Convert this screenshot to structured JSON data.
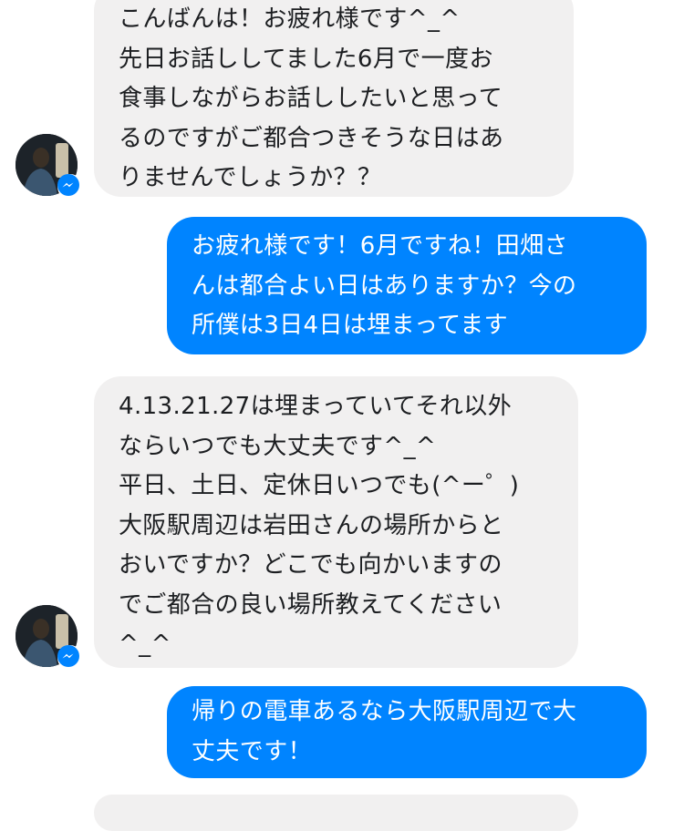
{
  "messages": [
    {
      "sender": "other",
      "lines": [
        "こんばんは！お疲れ様です^_^",
        "先日お話ししてました6月で一度お",
        "食事しながらお話ししたいと思って",
        "るのですがご都合つきそうな日はあ",
        "りませんでしょうか？？"
      ]
    },
    {
      "sender": "me",
      "lines": [
        "お疲れ様です！6月ですね！田畑さ",
        "んは都合よい日はありますか？今の",
        "所僕は3日4日は埋まってます"
      ]
    },
    {
      "sender": "other",
      "lines": [
        "4.13.21.27は埋まっていてそれ以外",
        "ならいつでも大丈夫です^_^",
        "平日、土日、定休日いつでも(^ー゜)",
        "大阪駅周辺は岩田さんの場所からと",
        "おいですか？どこでも向かいますの",
        "でご都合の良い場所教えてください",
        "^_^"
      ]
    },
    {
      "sender": "me",
      "lines": [
        "帰りの電車あるなら大阪駅周辺で大",
        "丈夫です！"
      ]
    }
  ],
  "colors": {
    "incoming_bubble": "#f1f0f0",
    "outgoing_bubble": "#0084ff",
    "messenger_badge": "#0084ff"
  },
  "icons": {
    "avatar": "contact-avatar",
    "badge": "messenger-icon"
  }
}
